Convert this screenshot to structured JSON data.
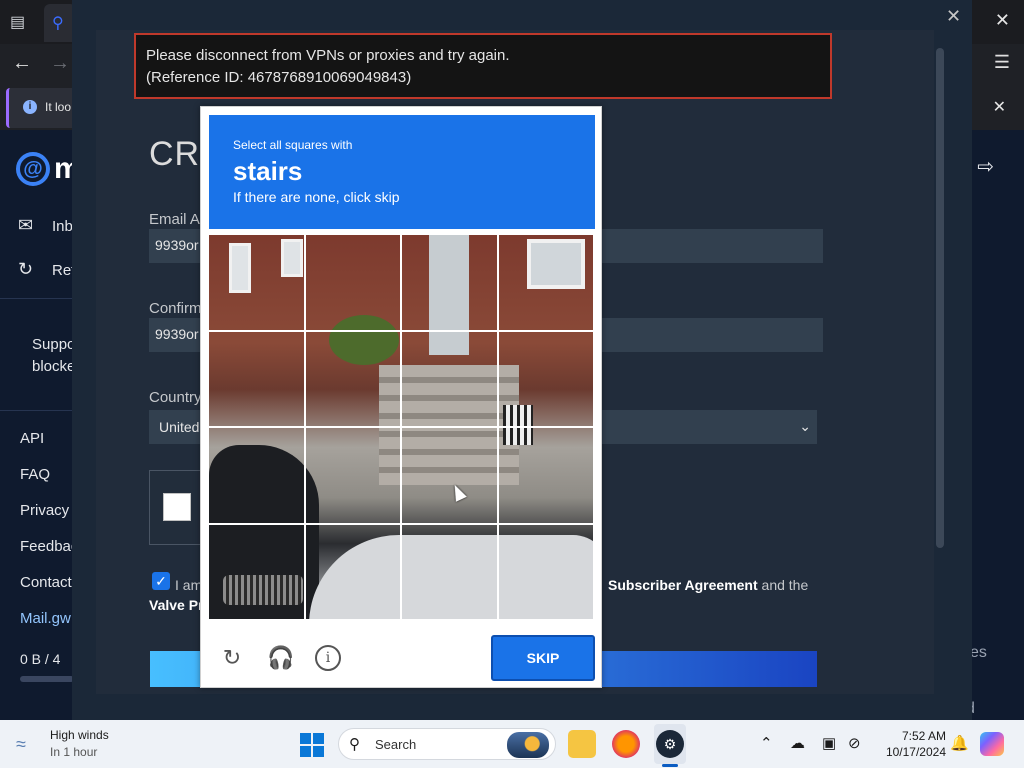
{
  "browser": {
    "notification_text": "It loo",
    "notification_info_glyph": "i"
  },
  "mail_sidebar": {
    "logo_letter": "m",
    "items": [
      {
        "label": "Inb",
        "icon": "inbox-icon"
      },
      {
        "label": "Ref",
        "icon": "refresh-icon"
      }
    ],
    "support_line1": "Suppo",
    "support_line2": "blocke",
    "links": [
      "API",
      "FAQ",
      "Privacy",
      "Feedbac",
      "Contact",
      "Mail.gw"
    ],
    "storage_text": "0 B  /  4"
  },
  "right_side": {
    "text1": "es",
    "text2": "d"
  },
  "steam_form": {
    "error_line1": "Please disconnect from VPNs or proxies and try again.",
    "error_line2": "(Reference ID: 4678768910069049843)",
    "heading": "CRI",
    "email_label": "Email Ac",
    "email_value": "9939or",
    "confirm_label": "Confirm",
    "confirm_value": "9939or",
    "country_label": "Country",
    "country_value": "United",
    "agree_prefix": "I am",
    "agree_link": "Subscriber Agreement",
    "agree_suffix": " and the",
    "valve_text": "Valve Pr"
  },
  "captcha": {
    "instruction_small": "Select all squares with",
    "target_word": "stairs",
    "instruction_sub": "If there are none, click skip",
    "skip_label": "SKIP",
    "grid_rows": 4,
    "grid_cols": 4
  },
  "taskbar": {
    "weather_title": "High winds",
    "weather_sub": "In 1 hour",
    "search_placeholder": "Search",
    "time": "7:52 AM",
    "date": "10/17/2024"
  }
}
